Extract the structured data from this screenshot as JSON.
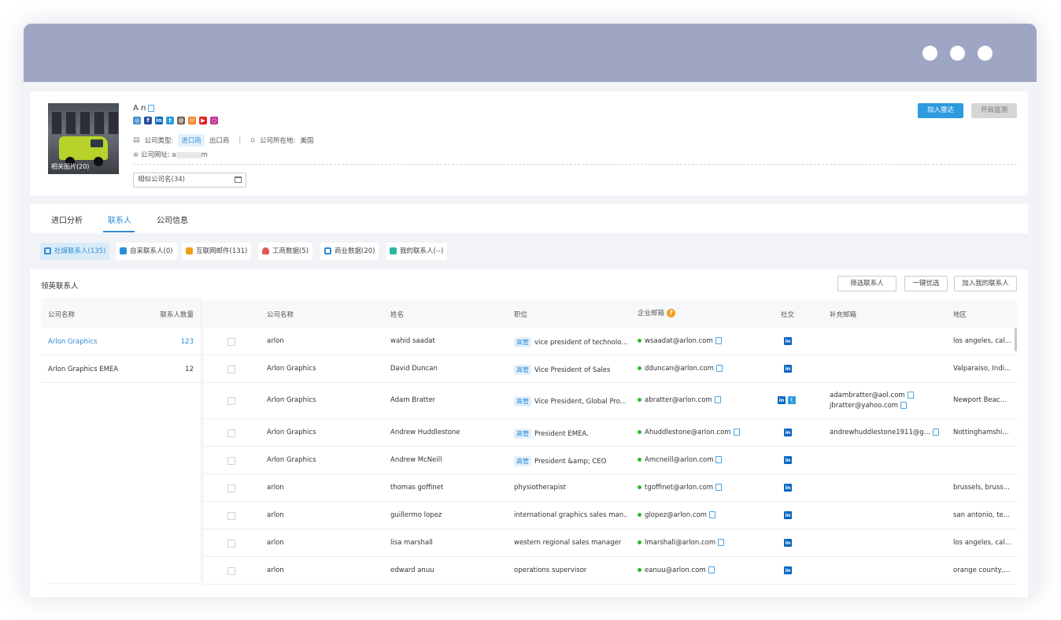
{
  "company": {
    "name_visible": "A    n",
    "photo_caption": "相关图片(20)",
    "type_label": "公司类型:",
    "type_import": "进口商",
    "type_export": "出口商",
    "separator": "|",
    "location_label": "公司所在地:",
    "location_value": "美国",
    "website_label": "公司网址:",
    "website_start": "a",
    "website_end": "m",
    "similar_label": "相似公司名(34)",
    "social_icons": [
      "website-icon",
      "facebook-icon",
      "linkedin-icon",
      "twitter-icon",
      "email-icon",
      "phone-icon",
      "youtube-icon",
      "instagram-icon"
    ]
  },
  "actions": {
    "add_radar": "加入雷达",
    "open_monitor": "开启监测"
  },
  "tabs": [
    "进口分析",
    "联系人",
    "公司信息"
  ],
  "active_tab": "联系人",
  "subtabs": [
    {
      "label": "社媒联系人(135)",
      "color": "#2d8cd8"
    },
    {
      "label": "自采联系人(0)",
      "color": "#2d8cd8"
    },
    {
      "label": "互联网邮件(131)",
      "color": "#f0a018"
    },
    {
      "label": "工商数据(5)",
      "color": "#e05a5a"
    },
    {
      "label": "商业数据(20)",
      "color": "#2d8cd8"
    },
    {
      "label": "我的联系人(--)",
      "color": "#2bb5a5"
    }
  ],
  "section": {
    "title": "领英联系人",
    "filter_btn": "筛选联系人",
    "optimize_btn": "一键优选",
    "add_btn": "加入我的联系人"
  },
  "left_panel": {
    "headers": [
      "公司名称",
      "联系人数量"
    ],
    "rows": [
      {
        "name": "Arlon Graphics",
        "count": "123"
      },
      {
        "name": "Arlon Graphics EMEA",
        "count": "12"
      }
    ]
  },
  "table": {
    "headers": [
      "公司名称",
      "姓名",
      "职位",
      "企业邮箱",
      "社交",
      "补充邮箱",
      "地区"
    ],
    "senior_badge": "高管",
    "rows": [
      {
        "company": "arlon",
        "name": "wahid saadat",
        "senior": true,
        "title": "vice president of technolo...",
        "email": "wsaadat@arlon.com",
        "twitter": false,
        "extra": [],
        "region": "los angeles, cal..."
      },
      {
        "company": "Arlon Graphics",
        "name": "David Duncan",
        "senior": true,
        "title": "Vice President of Sales",
        "email": "dduncan@arlon.com",
        "twitter": false,
        "extra": [],
        "region": "Valparaiso, Indi..."
      },
      {
        "company": "Arlon Graphics",
        "name": "Adam Bratter",
        "senior": true,
        "title": "Vice President, Global Pro...",
        "email": "abratter@arlon.com",
        "twitter": true,
        "extra": [
          "adambratter@aol.com",
          "jbratter@yahoo.com"
        ],
        "region": "Newport Beac..."
      },
      {
        "company": "Arlon Graphics",
        "name": "Andrew Huddlestone",
        "senior": true,
        "title": "President EMEA.",
        "email": "Ahuddlestone@arlon.com",
        "twitter": false,
        "extra": [
          "andrewhuddlestone1911@g..."
        ],
        "region": "Nottinghamshi..."
      },
      {
        "company": "Arlon Graphics",
        "name": "Andrew McNeill",
        "senior": true,
        "title": "President &amp; CEO",
        "email": "Amcneill@arlon.com",
        "twitter": false,
        "extra": [],
        "region": ""
      },
      {
        "company": "arlon",
        "name": "thomas goffinet",
        "senior": false,
        "title": "physiotherapist",
        "email": "tgoffinet@arlon.com",
        "twitter": false,
        "extra": [],
        "region": "brussels, bruss..."
      },
      {
        "company": "arlon",
        "name": "guillermo lopez",
        "senior": false,
        "title": "international graphics sales man...",
        "email": "glopez@arlon.com",
        "twitter": false,
        "extra": [],
        "region": "san antonio, te..."
      },
      {
        "company": "arlon",
        "name": "lisa marshall",
        "senior": false,
        "title": "western regional sales manager",
        "email": "lmarshall@arlon.com",
        "twitter": false,
        "extra": [],
        "region": "los angeles, cal..."
      },
      {
        "company": "arlon",
        "name": "edward anuu",
        "senior": false,
        "title": "operations supervisor",
        "email": "eanuu@arlon.com",
        "twitter": false,
        "extra": [],
        "region": "orange county,..."
      }
    ]
  },
  "colors": {
    "accent": "#2d8cd8",
    "titlebar": "#9ea6c4",
    "linkedin": "#0a66c2",
    "email_ok": "#2eb82e",
    "help": "#f0a018"
  }
}
